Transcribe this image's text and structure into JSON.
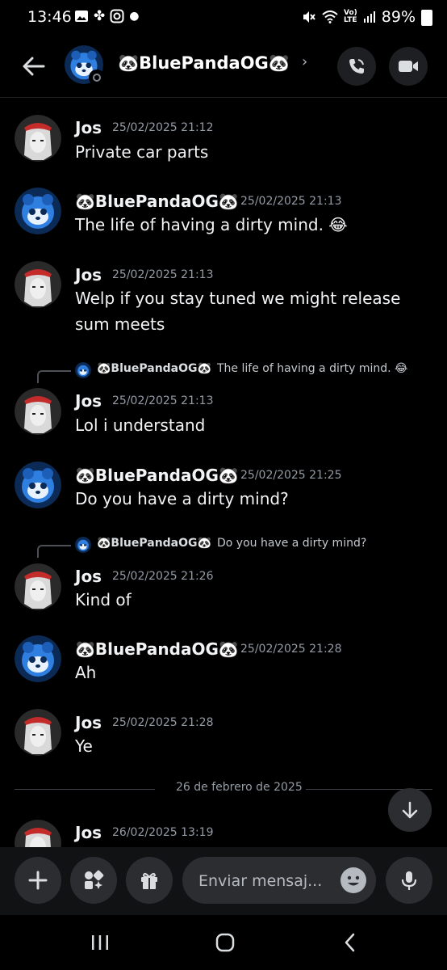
{
  "status_bar": {
    "time": "13:46",
    "battery": "89%",
    "left_icons": [
      "gallery-icon",
      "pinwheel-icon",
      "instagram-icon",
      "dot-icon"
    ],
    "right_icons": [
      "mute-icon",
      "wifi-icon",
      "volte-icon",
      "signal-icon",
      "battery-icon"
    ]
  },
  "header": {
    "title": "🐼BluePandaOG🐼",
    "chevron": "›"
  },
  "messages": [
    {
      "author": "Jos",
      "timestamp": "25/02/2025 21:12",
      "text": "Private car parts"
    },
    {
      "author": "🐼BluePandaOG🐼",
      "timestamp": "25/02/2025 21:13",
      "text": "The life of having a dirty mind. 😂"
    },
    {
      "author": "Jos",
      "timestamp": "25/02/2025 21:13",
      "text": "Welp if you stay tuned we might release sum meets"
    },
    {
      "author": "Jos",
      "timestamp": "25/02/2025 21:13",
      "text": "Lol i understand",
      "reply": {
        "author": "🐼BluePandaOG🐼",
        "text": "The life of having a dirty mind. 😂"
      }
    },
    {
      "author": "🐼BluePandaOG🐼",
      "timestamp": "25/02/2025 21:25",
      "text": "Do you have a dirty mind?"
    },
    {
      "author": "Jos",
      "timestamp": "25/02/2025 21:26",
      "text": "Kind of",
      "reply": {
        "author": "🐼BluePandaOG🐼",
        "text": "Do you have a dirty mind?"
      }
    },
    {
      "author": "🐼BluePandaOG🐼",
      "timestamp": "25/02/2025 21:28",
      "text": "Ah"
    },
    {
      "author": "Jos",
      "timestamp": "25/02/2025 21:28",
      "text": "Ye"
    },
    {
      "author": "Jos",
      "timestamp": "26/02/2025 13:19",
      "text": ""
    }
  ],
  "divider": {
    "label": "26 de febrero de 2025"
  },
  "composer": {
    "placeholder": "Enviar mensaj..."
  },
  "colors": {
    "background": "#000000",
    "text": "#f2f3f5",
    "muted": "#949ba4",
    "button_bg": "#2b2d31",
    "panda_blue": "#2f7fe0"
  }
}
